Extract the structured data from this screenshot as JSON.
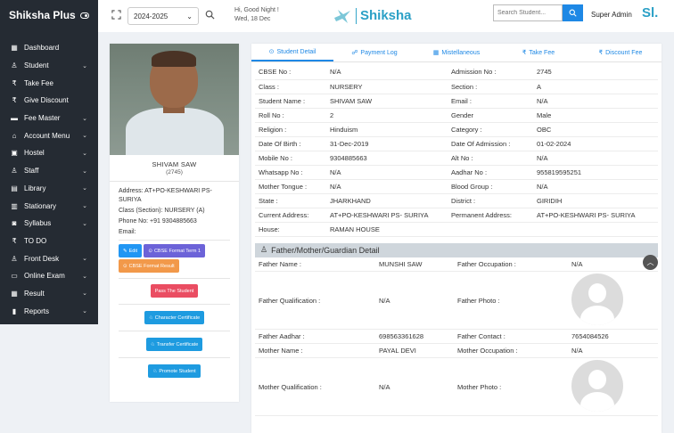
{
  "sidebar": {
    "brand": "Shiksha Plus",
    "items": [
      {
        "label": "Dashboard",
        "icon": "dashboard-icon",
        "glyph": "▦",
        "chevron": false
      },
      {
        "label": "Student",
        "icon": "user-icon",
        "glyph": "♙",
        "chevron": true
      },
      {
        "label": "Take Fee",
        "icon": "rupee-icon",
        "glyph": "₹",
        "chevron": false
      },
      {
        "label": "Give Discount",
        "icon": "rupee-icon",
        "glyph": "₹",
        "chevron": false
      },
      {
        "label": "Fee Master",
        "icon": "cash-icon",
        "glyph": "▬",
        "chevron": true
      },
      {
        "label": "Account Menu",
        "icon": "bank-icon",
        "glyph": "⌂",
        "chevron": true
      },
      {
        "label": "Hostel",
        "icon": "hostel-icon",
        "glyph": "▣",
        "chevron": true
      },
      {
        "label": "Staff",
        "icon": "staff-icon",
        "glyph": "♙",
        "chevron": true
      },
      {
        "label": "Library",
        "icon": "library-icon",
        "glyph": "▤",
        "chevron": true
      },
      {
        "label": "Stationary",
        "icon": "stationary-icon",
        "glyph": "▥",
        "chevron": true
      },
      {
        "label": "Syllabus",
        "icon": "syllabus-icon",
        "glyph": "◙",
        "chevron": true
      },
      {
        "label": "TO DO",
        "icon": "rupee-icon",
        "glyph": "₹",
        "chevron": false
      },
      {
        "label": "Front Desk",
        "icon": "front-desk-icon",
        "glyph": "♙",
        "chevron": true
      },
      {
        "label": "Online Exam",
        "icon": "exam-icon",
        "glyph": "▭",
        "chevron": true
      },
      {
        "label": "Result",
        "icon": "result-icon",
        "glyph": "▦",
        "chevron": true
      },
      {
        "label": "Reports",
        "icon": "chart-icon",
        "glyph": "▮",
        "chevron": true
      }
    ]
  },
  "topbar": {
    "session": "2024-2025",
    "greeting_line1": "Hi, Good Night !",
    "greeting_line2": "Wed, 18 Dec",
    "logo_text": "Shiksha",
    "search_placeholder": "Search Student...",
    "user": "Super Admin",
    "user_logo": "Sl."
  },
  "profile": {
    "name": "SHIVAM SAW",
    "admission_no": "(2745)",
    "address": "Address: AT+PO-KESHWARI PS- SURIYA",
    "class_section": "Class (Section): NURSERY (A)",
    "phone": "Phone No: +91 9304885663",
    "email": "Email:",
    "buttons": {
      "edit": "Edit",
      "cbse_term1": "CBSE Format Term 1",
      "cbse_result": "CBSE Format Result",
      "pass": "Pass The Student",
      "character": "Character Certificate",
      "transfer": "Transfer Certificate",
      "promote": "Promote Student"
    }
  },
  "tabs": [
    {
      "label": "Student Detail",
      "glyph": "⊙"
    },
    {
      "label": "Payment Log",
      "glyph": "☍"
    },
    {
      "label": "Mistellaneous",
      "glyph": "▦"
    },
    {
      "label": "Take Fee",
      "glyph": "₹"
    },
    {
      "label": "Discount Fee",
      "glyph": "₹"
    }
  ],
  "student_info": [
    [
      "CBSE No :",
      "N/A",
      "Admission No :",
      "2745"
    ],
    [
      "Class :",
      "NURSERY",
      "Section :",
      "A"
    ],
    [
      "Student Name :",
      "SHIVAM SAW",
      "Email :",
      "N/A"
    ],
    [
      "Roll No :",
      "2",
      "Gender",
      "Male"
    ],
    [
      "Religion :",
      "Hinduism",
      "Category :",
      "OBC"
    ],
    [
      "Date Of Birth :",
      "31-Dec-2019",
      "Date Of Admission :",
      "01-02-2024"
    ],
    [
      "Mobile No :",
      "9304885663",
      "Alt No :",
      "N/A"
    ],
    [
      "Whatsapp No :",
      "N/A",
      "Aadhar No :",
      "955819595251"
    ],
    [
      "Mother Tongue :",
      "N/A",
      "Blood Group :",
      "N/A"
    ],
    [
      "State :",
      "JHARKHAND",
      "District :",
      "GIRIDIH"
    ],
    [
      "Current Address:",
      "AT+PO-KESHWARI PS- SURIYA",
      "Permanent Address:",
      "AT+PO-KESHWARI PS- SURIYA"
    ],
    [
      "House:",
      "RAMAN HOUSE",
      "",
      ""
    ]
  ],
  "guardian": {
    "title": "Father/Mother/Guardian Detail",
    "rows": [
      {
        "l1": "Father Name :",
        "v1": "MUNSHI SAW",
        "l2": "Father Occupation :",
        "v2": "N/A"
      },
      {
        "l1": "Father Qualification :",
        "v1": "N/A",
        "l2": "Father Photo :",
        "v2": "",
        "photo": "male-avatar-icon"
      },
      {
        "l1": "Father Aadhar :",
        "v1": "698563361628",
        "l2": "Father Contact :",
        "v2": "7654084526"
      },
      {
        "l1": "Mother Name :",
        "v1": "PAYAL DEVI",
        "l2": "Mother Occupation :",
        "v2": "N/A"
      },
      {
        "l1": "Mother Qualification :",
        "v1": "N/A",
        "l2": "Mother Photo :",
        "v2": "",
        "photo": "female-avatar-icon"
      }
    ]
  }
}
